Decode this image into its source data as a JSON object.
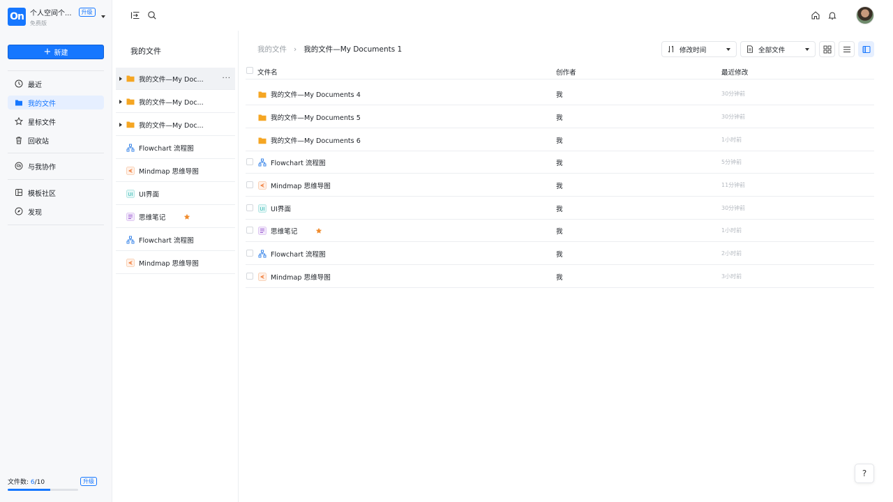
{
  "workspace": {
    "logo": "On",
    "name": "个人空间个...",
    "upgrade": "升级",
    "plan": "免费版"
  },
  "sidebar": {
    "new_label": "新建",
    "items": [
      {
        "label": "最近",
        "icon": "clock-icon"
      },
      {
        "label": "我的文件",
        "icon": "folder-icon",
        "active": true
      },
      {
        "label": "星标文件",
        "icon": "star-icon"
      },
      {
        "label": "回收站",
        "icon": "trash-icon"
      },
      {
        "label": "与我协作",
        "icon": "collab-icon"
      },
      {
        "label": "模板社区",
        "icon": "template-icon"
      },
      {
        "label": "发现",
        "icon": "compass-icon"
      }
    ],
    "footer": {
      "label": "文件数: ",
      "used": "6",
      "total": "/10",
      "upgrade": "升级",
      "fraction": 0.6
    }
  },
  "tree": {
    "title": "我的文件",
    "items": [
      {
        "label": "我的文件—My Doc...",
        "type": "folder",
        "expandable": true,
        "selected": true,
        "more": "···"
      },
      {
        "label": "我的文件—My Doc...",
        "type": "folder",
        "expandable": true
      },
      {
        "label": "我的文件—My Doc...",
        "type": "folder",
        "expandable": true
      },
      {
        "label": "Flowchart 流程图",
        "type": "flowchart"
      },
      {
        "label": "Mindmap 思维导图",
        "type": "mindmap"
      },
      {
        "label": "UI界面",
        "type": "ui"
      },
      {
        "label": "思维笔记",
        "type": "note",
        "starred": true
      },
      {
        "label": "Flowchart 流程图",
        "type": "flowchart"
      },
      {
        "label": "Mindmap 思维导图",
        "type": "mindmap"
      }
    ]
  },
  "breadcrumb": {
    "parent": "我的文件",
    "separator": "›",
    "current": "我的文件—My Documents 1"
  },
  "toolbar": {
    "sort_label": "修改时间",
    "filter_label": "全部文件"
  },
  "table": {
    "headers": {
      "name": "文件名",
      "author": "创作者",
      "modified": "最近修改"
    },
    "rows": [
      {
        "name": "我的文件—My Documents 4",
        "type": "folder",
        "author": "我",
        "modified": "30分钟前"
      },
      {
        "name": "我的文件—My Documents 5",
        "type": "folder",
        "author": "我",
        "modified": "30分钟前"
      },
      {
        "name": "我的文件—My Documents 6",
        "type": "folder",
        "author": "我",
        "modified": "1小时前"
      },
      {
        "name": "Flowchart 流程图",
        "type": "flowchart",
        "author": "我",
        "modified": "5分钟前"
      },
      {
        "name": "Mindmap 思维导图",
        "type": "mindmap",
        "author": "我",
        "modified": "11分钟前"
      },
      {
        "name": "UI界面",
        "type": "ui",
        "author": "我",
        "modified": "30分钟前"
      },
      {
        "name": "思维笔记",
        "type": "note",
        "author": "我",
        "modified": "1小时前",
        "starred": true
      },
      {
        "name": "Flowchart 流程图",
        "type": "flowchart",
        "author": "我",
        "modified": "2小时前"
      },
      {
        "name": "Mindmap 思维导图",
        "type": "mindmap",
        "author": "我",
        "modified": "3小时前"
      }
    ]
  },
  "help_label": "?",
  "colors": {
    "accent": "#1677ff",
    "folder": "#f5a623",
    "star": "#f08c2e",
    "ui_icon": "#2bb5b0",
    "note_icon": "#9b59d0",
    "mindmap_icon": "#f07d3a",
    "flowchart_icon": "#3a86e8"
  }
}
